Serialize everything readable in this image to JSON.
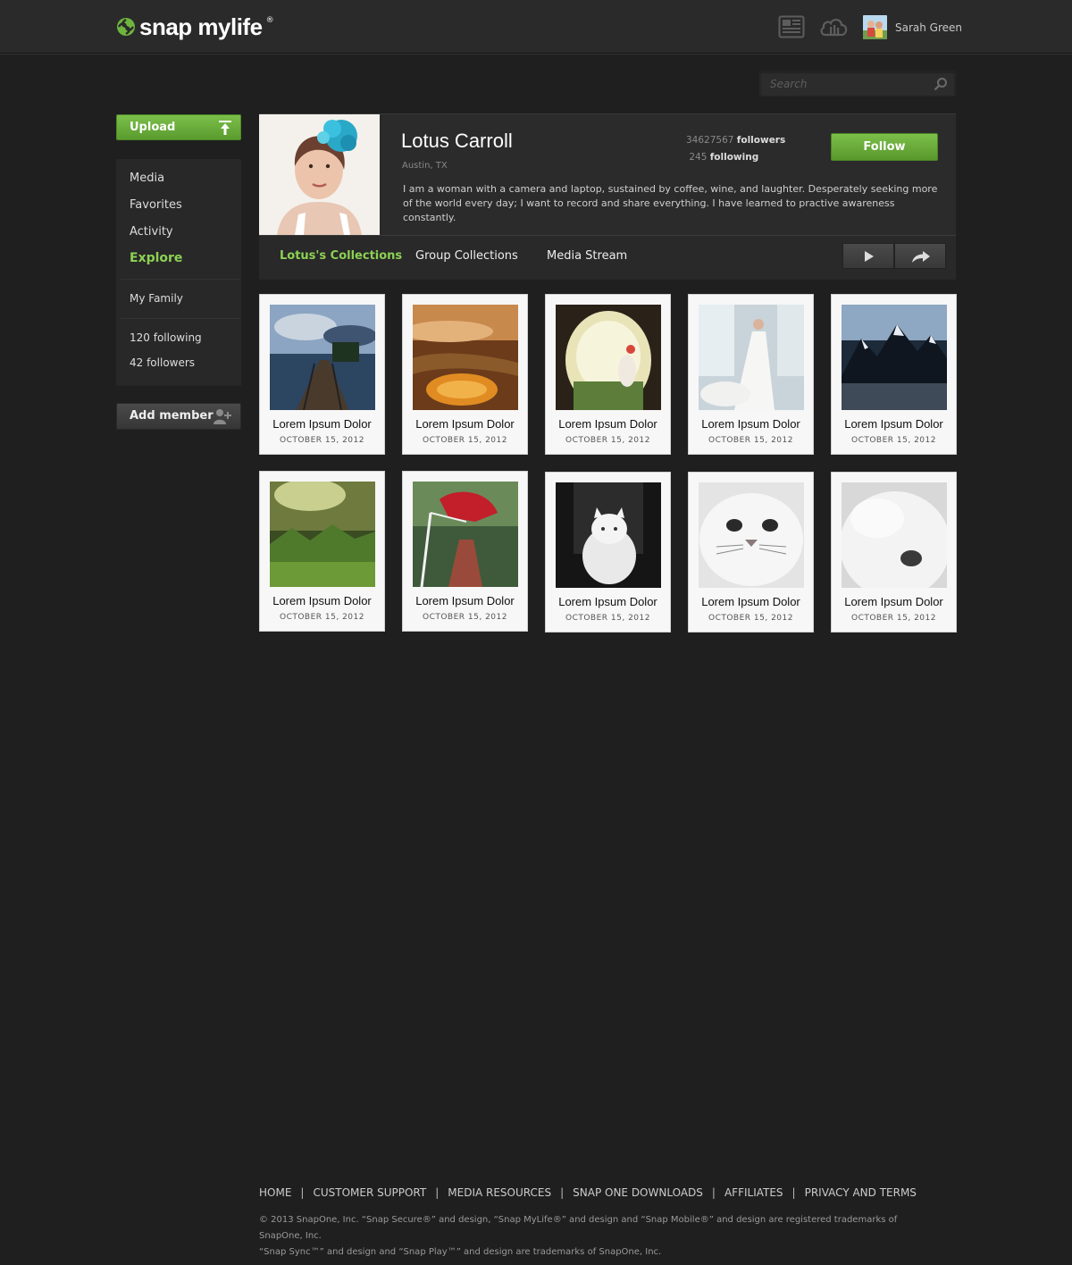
{
  "header": {
    "brand": "snap mylife",
    "brand_reg": "®",
    "user_name": "Sarah Green",
    "icons": [
      "news-icon",
      "cloud-icon"
    ]
  },
  "search": {
    "placeholder": "Search"
  },
  "sidebar": {
    "upload_label": "Upload",
    "items": [
      {
        "label": "Media"
      },
      {
        "label": "Favorites"
      },
      {
        "label": "Activity"
      },
      {
        "label": "Explore",
        "active": true
      }
    ],
    "group_label": "My Family",
    "following": "120 following",
    "followers": "42 followers",
    "add_member_label": "Add member"
  },
  "profile": {
    "name": "Lotus Carroll",
    "location": "Austin, TX",
    "bio": "I am a woman with a camera and laptop, sustained by coffee, wine, and laughter. Desperately seeking more of the world every day; I want to record and share everything. I have learned to practive awareness constantly.",
    "followers_count": "34627567",
    "followers_label": "followers",
    "following_count": "245",
    "following_label": "following",
    "follow_label": "Follow",
    "tabs": [
      {
        "label": "Lotus's Collections",
        "active": true
      },
      {
        "label": "Group Collections"
      },
      {
        "label": "Media Stream"
      }
    ]
  },
  "collections": [
    {
      "title": "Lorem Ipsum Dolor",
      "date": "OCTOBER 15, 2012",
      "scene": "boardwalk"
    },
    {
      "title": "Lorem Ipsum Dolor",
      "date": "OCTOBER 15, 2012",
      "scene": "rice-terrace"
    },
    {
      "title": "Lorem Ipsum Dolor",
      "date": "OCTOBER 15, 2012",
      "scene": "tunnel-fairy"
    },
    {
      "title": "Lorem Ipsum Dolor",
      "date": "OCTOBER 15, 2012",
      "scene": "bride"
    },
    {
      "title": "Lorem Ipsum Dolor",
      "date": "OCTOBER 15, 2012",
      "scene": "mountains"
    },
    {
      "title": "Lorem Ipsum Dolor",
      "date": "OCTOBER 15, 2012",
      "scene": "green-valley"
    },
    {
      "title": "Lorem Ipsum Dolor",
      "date": "OCTOBER 15, 2012",
      "scene": "red-dress"
    },
    {
      "title": "Lorem Ipsum Dolor",
      "date": "OCTOBER 15, 2012",
      "scene": "white-cat-sitting"
    },
    {
      "title": "Lorem Ipsum Dolor",
      "date": "OCTOBER 15, 2012",
      "scene": "white-cat-face"
    },
    {
      "title": "Lorem Ipsum Dolor",
      "date": "OCTOBER 15, 2012",
      "scene": "white-cat-closeup"
    }
  ],
  "footer": {
    "links": [
      "HOME",
      "CUSTOMER SUPPORT",
      "MEDIA RESOURCES",
      "SNAP ONE DOWNLOADS",
      "AFFILIATES",
      "PRIVACY AND TERMS"
    ],
    "copyright_1": "© 2013 SnapOne, Inc. “Snap Secure®” and design, “Snap MyLife®” and design and “Snap Mobile®” and design are registered trademarks of SnapOne, Inc.",
    "copyright_2": "“Snap Sync™” and design and “Snap Play™” and design are trademarks of SnapOne, Inc."
  },
  "colors": {
    "accent_green": "#7cbf4a",
    "active_nav": "#8cd153",
    "background": "#1f1f1f"
  }
}
